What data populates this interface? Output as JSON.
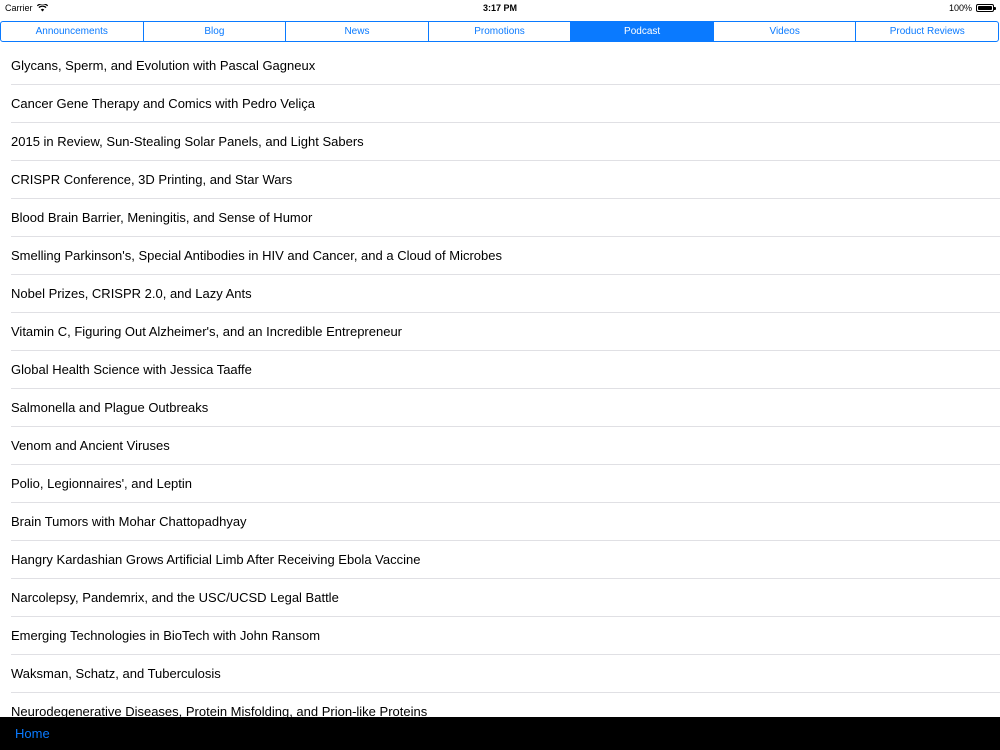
{
  "status_bar": {
    "carrier": "Carrier",
    "time": "3:17 PM",
    "battery": "100%",
    "icons": [
      "wifi-icon",
      "battery-icon"
    ]
  },
  "segments": [
    {
      "label": "Announcements",
      "selected": false
    },
    {
      "label": "Blog",
      "selected": false
    },
    {
      "label": "News",
      "selected": false
    },
    {
      "label": "Promotions",
      "selected": false
    },
    {
      "label": "Podcast",
      "selected": true
    },
    {
      "label": "Videos",
      "selected": false
    },
    {
      "label": "Product Reviews",
      "selected": false
    }
  ],
  "episodes": [
    "Glycans, Sperm, and Evolution with Pascal Gagneux",
    "Cancer Gene Therapy and Comics with Pedro Veliça",
    "2015 in Review, Sun-Stealing Solar Panels, and Light Sabers",
    "CRISPR Conference, 3D Printing, and Star Wars",
    "Blood Brain Barrier, Meningitis, and Sense of Humor",
    "Smelling Parkinson's, Special Antibodies in HIV and Cancer, and a Cloud of Microbes",
    "Nobel Prizes, CRISPR 2.0, and Lazy Ants",
    "Vitamin C, Figuring Out Alzheimer's, and an Incredible Entrepreneur",
    "Global Health Science with Jessica Taaffe",
    "Salmonella and Plague Outbreaks",
    "Venom and Ancient Viruses",
    "Polio, Legionnaires', and Leptin",
    "Brain Tumors with Mohar Chattopadhyay",
    "Hangry Kardashian Grows Artificial Limb After Receiving Ebola Vaccine",
    "Narcolepsy, Pandemrix, and the USC/UCSD Legal Battle",
    "Emerging Technologies in BioTech with John Ransom",
    "Waksman, Schatz, and Tuberculosis",
    "Neurodegenerative Diseases, Protein Misfolding, and Prion-like Proteins"
  ],
  "tab_bar": {
    "home_label": "Home"
  },
  "colors": {
    "accent": "#0a7aff",
    "tab_bar_bg": "#000000",
    "separator": "#e0e0e4"
  }
}
